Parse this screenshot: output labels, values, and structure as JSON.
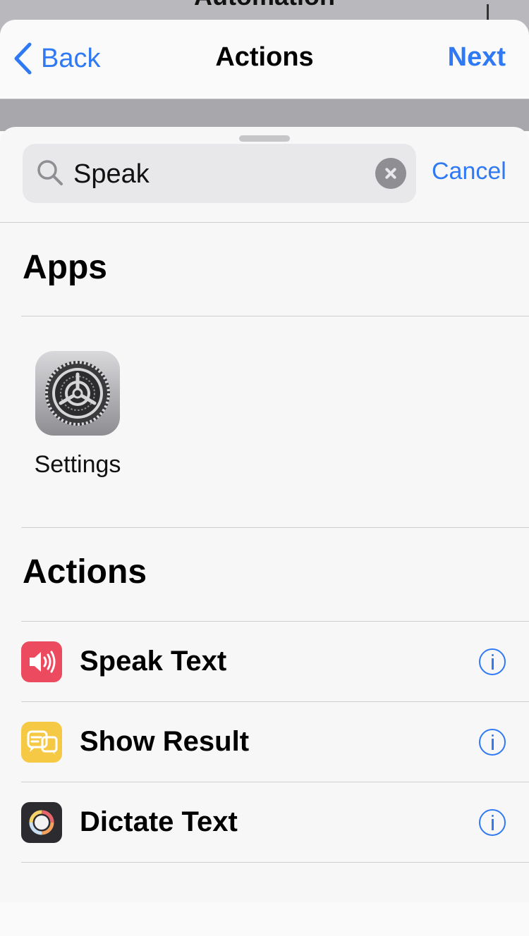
{
  "background": {
    "title": "Automation"
  },
  "nav": {
    "back_label": "Back",
    "title": "Actions",
    "next_label": "Next"
  },
  "search": {
    "value": "Speak",
    "placeholder": "",
    "cancel_label": "Cancel"
  },
  "apps_section": {
    "title": "Apps",
    "items": [
      {
        "label": "Settings",
        "icon": "settings-gear-icon"
      }
    ]
  },
  "actions_section": {
    "title": "Actions",
    "items": [
      {
        "label": "Speak Text",
        "icon": "speaker-icon",
        "color": "#ec4a5e"
      },
      {
        "label": "Show Result",
        "icon": "message-icon",
        "color": "#f6c945"
      },
      {
        "label": "Dictate Text",
        "icon": "dictation-icon",
        "color": "#2b2b30"
      }
    ]
  },
  "colors": {
    "accent": "#2f7af4"
  }
}
